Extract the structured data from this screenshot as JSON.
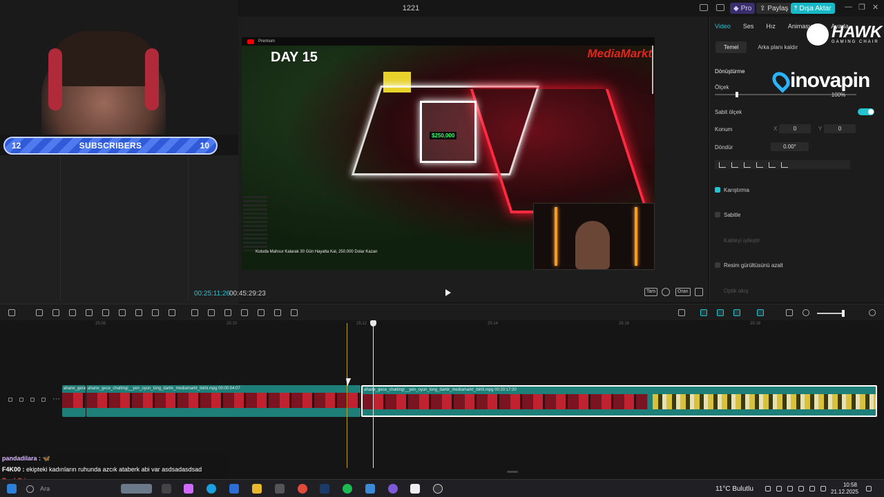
{
  "overlay": {
    "subscribers": {
      "left": "12",
      "label": "SUBSCRIBERS",
      "right": "10"
    }
  },
  "window": {
    "title": "1221",
    "pro_label": "Pro",
    "share_label": "Paylaş",
    "export_label": "Dışa Aktar",
    "controls": [
      "—",
      "❐",
      "✕"
    ]
  },
  "player": {
    "video": {
      "day_text": "DAY 15",
      "brand_text": "MediaMarkt",
      "premium_text": "Premium",
      "money_text": "$250,000",
      "caption_text": "Kutuda Mahsur Kalarak 30 Gün Hayatta Kal, 250.000 Dolar Kazan"
    },
    "current_time": "00:25:11:26",
    "total_time": "00:45:29:23",
    "controls": {
      "full_label": "Tam",
      "ratio_label": "Oran"
    }
  },
  "inspector": {
    "tabs": [
      "Video",
      "Ses",
      "Hız",
      "Animasyon",
      "Ayarla"
    ],
    "subtabs": [
      "Temel",
      "Arka planı kaldır"
    ],
    "sponsor_hawk": {
      "title": "HAWK",
      "subtitle": "GAMING CHAIR"
    },
    "sponsor_inova": "inovapin",
    "transform_label": "Dönüştürme",
    "scale_label": "Ölçek",
    "scale_value": "100%",
    "uniform_scale_label": "Sabit ölçek",
    "position_label": "Konum",
    "pos_x_label": "X",
    "pos_x": "0",
    "pos_y_label": "Y",
    "pos_y": "0",
    "rotate_label": "Döndür",
    "rotate_value": "0.00°",
    "blend_label": "Karıştırma",
    "stabilize_label": "Sabitle",
    "quality_label": "Kaliteyi iyileştir",
    "denoise_label": "Resim gürültüsünü azalt",
    "optical_flow_label": "Optik akış"
  },
  "timeline": {
    "ticks": [
      "25:08",
      "25:10",
      "25:12",
      "25:14",
      "25:16",
      "25:18"
    ],
    "clips": [
      {
        "label": "ahane_gece_cha"
      },
      {
        "label": "ahane_gece_chattingi__yen_oyun_long_darkk_mediamarkt_ibirlii.mpg   00:00:04:07"
      },
      {
        "label": "ahane_gece_chattingi__yen_oyun_long_darkk_mediamarkt_ibirlii.mpg   00:20:17:20"
      }
    ]
  },
  "chat": {
    "messages": [
      {
        "user": "pandadilara :",
        "text": "🦋"
      },
      {
        "user": "F4K00 :",
        "text": "ekipteki kadınların ruhunda azcık ataberk abi var asdsadasdsad"
      },
      {
        "user": "PunkCrime :",
        "text": ""
      }
    ]
  },
  "taskbar": {
    "search_label": "Ara",
    "weather": "11°C  Bulutlu",
    "time": "10:58",
    "date": "21.12.2025"
  },
  "colors": {
    "accent": "#25c3cf",
    "export": "#18b9c6",
    "pro": "#3a2f6a",
    "marker": "#b8a22c",
    "clip": "#1e7f78"
  }
}
